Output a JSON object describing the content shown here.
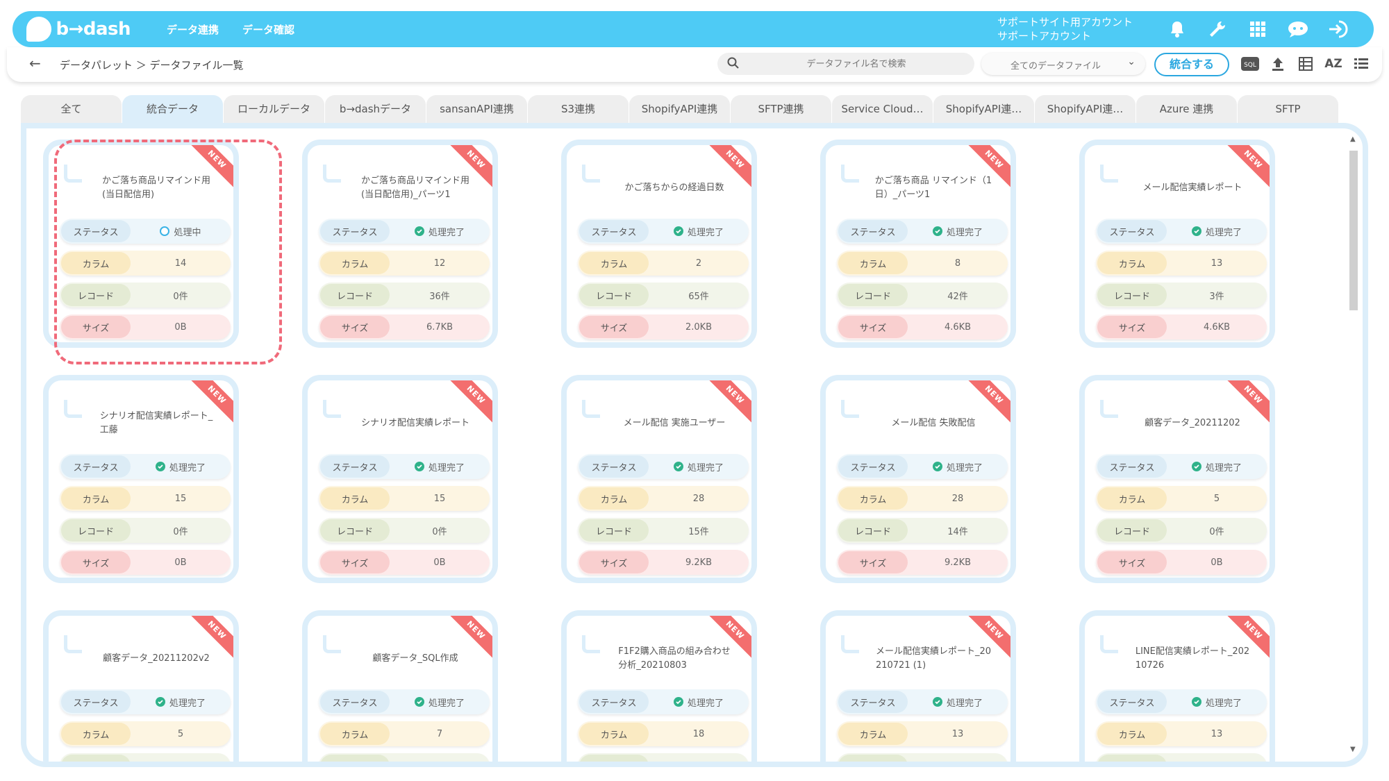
{
  "header": {
    "logo_text": "b→dash",
    "nav": [
      "データ連携",
      "データ確認"
    ],
    "account_line1": "サポートサイト用アカウント",
    "account_line2": "サポートアカウント",
    "icons": [
      "bell-icon",
      "wrench-icon",
      "grid-icon",
      "chat-icon",
      "logout-icon"
    ]
  },
  "toolbar": {
    "breadcrumb": "データパレット ＞ データファイル一覧",
    "search_placeholder": "データファイル名で検索",
    "filter_value": "全てのデータファイル",
    "merge_label": "統合する",
    "sql_label": "SQL",
    "sort_label": "AZ"
  },
  "tabs": [
    "全て",
    "統合データ",
    "ローカルデータ",
    "b→dashデータ",
    "sansanAPI連携",
    "S3連携",
    "ShopifyAPI連携",
    "SFTP連携",
    "Service Cloud…",
    "ShopifyAPI連…",
    "ShopifyAPI連…",
    "Azure 連携",
    "SFTP"
  ],
  "active_tab": 1,
  "labels": {
    "status": "ステータス",
    "column": "カラム",
    "record": "レコード",
    "size": "サイズ",
    "new": "NEW"
  },
  "cards": [
    {
      "title": [
        "かご落ち商品リマインド用",
        "(当日配信用)"
      ],
      "status": "処理中",
      "state": "processing",
      "column": "14",
      "record": "0件",
      "size": "0B"
    },
    {
      "title": [
        "かご落ち商品リマインド用",
        "(当日配信用)_パーツ1"
      ],
      "status": "処理完了",
      "state": "done",
      "column": "12",
      "record": "36件",
      "size": "6.7KB"
    },
    {
      "title": [
        "かご落ちからの経過日数"
      ],
      "status": "処理完了",
      "state": "done",
      "column": "2",
      "record": "65件",
      "size": "2.0KB"
    },
    {
      "title": [
        "かご落ち商品 リマインド（1",
        "日）_パーツ1"
      ],
      "status": "処理完了",
      "state": "done",
      "column": "8",
      "record": "42件",
      "size": "4.6KB"
    },
    {
      "title": [
        "メール配信実績レポート"
      ],
      "status": "処理完了",
      "state": "done",
      "column": "13",
      "record": "3件",
      "size": "4.6KB"
    },
    {
      "title": [
        "シナリオ配信実績レポート_",
        "工藤"
      ],
      "status": "処理完了",
      "state": "done",
      "column": "15",
      "record": "0件",
      "size": "0B"
    },
    {
      "title": [
        "シナリオ配信実績レポート"
      ],
      "status": "処理完了",
      "state": "done",
      "column": "15",
      "record": "0件",
      "size": "0B"
    },
    {
      "title": [
        "メール配信 実施ユーザー"
      ],
      "status": "処理完了",
      "state": "done",
      "column": "28",
      "record": "15件",
      "size": "9.2KB"
    },
    {
      "title": [
        "メール配信 失敗配信"
      ],
      "status": "処理完了",
      "state": "done",
      "column": "28",
      "record": "14件",
      "size": "9.2KB"
    },
    {
      "title": [
        "顧客データ_20211202"
      ],
      "status": "処理完了",
      "state": "done",
      "column": "5",
      "record": "0件",
      "size": "0B"
    },
    {
      "title": [
        "顧客データ_20211202v2"
      ],
      "status": "処理完了",
      "state": "done",
      "column": "5",
      "record": "",
      "size": ""
    },
    {
      "title": [
        "顧客データ_SQL作成"
      ],
      "status": "処理完了",
      "state": "done",
      "column": "7",
      "record": "",
      "size": ""
    },
    {
      "title": [
        "F1F2購入商品の組み合わせ",
        "分析_20210803"
      ],
      "status": "処理完了",
      "state": "done",
      "column": "18",
      "record": "",
      "size": ""
    },
    {
      "title": [
        "メール配信実績レポート_20",
        "210721 (1)"
      ],
      "status": "処理完了",
      "state": "done",
      "column": "13",
      "record": "",
      "size": ""
    },
    {
      "title": [
        "LINE配信実績レポート_202",
        "10726"
      ],
      "status": "処理完了",
      "state": "done",
      "column": "13",
      "record": "",
      "size": ""
    }
  ]
}
